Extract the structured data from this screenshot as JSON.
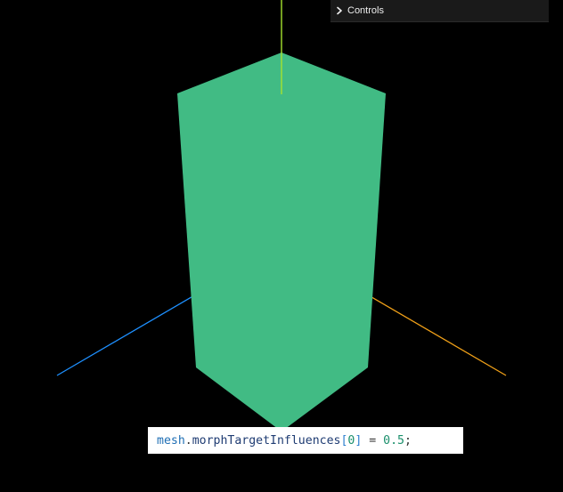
{
  "controls": {
    "label": "Controls",
    "chevron_icon": "chevron-right-icon"
  },
  "scene": {
    "mesh_color": "#41bb84",
    "axis_y_color": "#a6e22e",
    "axis_x_color": "#f0a018",
    "axis_z_color": "#1e90ff",
    "background": "#000000"
  },
  "code": {
    "object": "mesh",
    "dot": ".",
    "property": "morphTargetInfluences",
    "open_bracket": "[",
    "index": "0",
    "close_bracket": "]",
    "operator": " = ",
    "value": "0.5",
    "semicolon": ";"
  }
}
